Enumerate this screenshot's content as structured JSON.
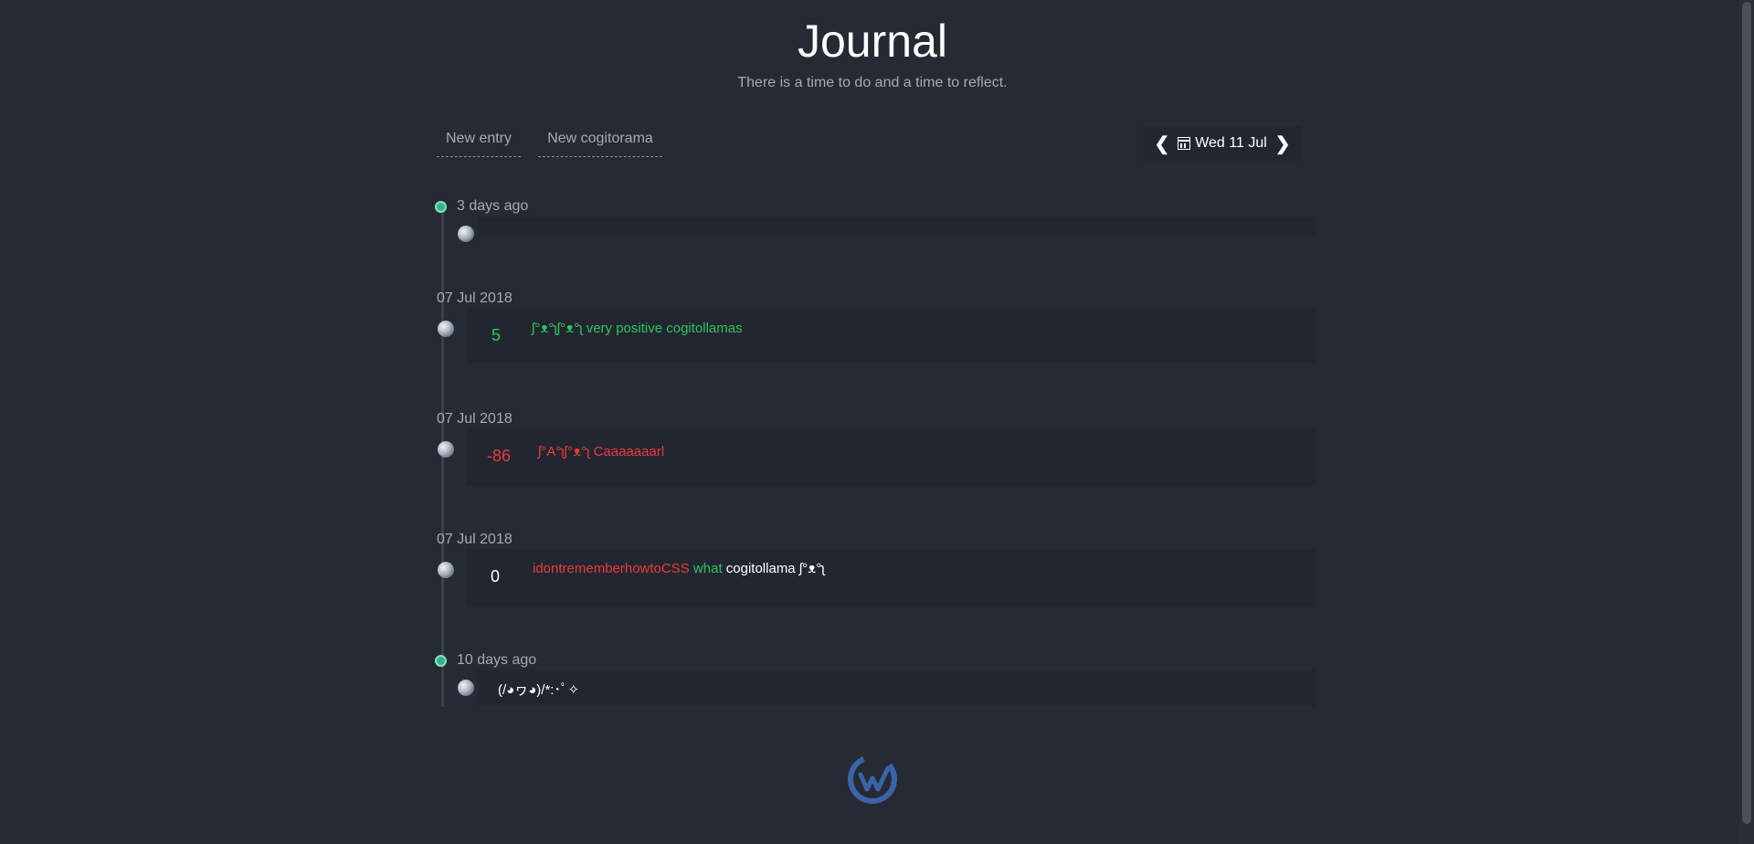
{
  "header": {
    "title": "Journal",
    "subtitle": "There is a time to do and a time to reflect."
  },
  "actions": {
    "new_entry": "New entry",
    "new_cogitorama": "New cogitorama"
  },
  "date_nav": {
    "prev_icon": "chevron-left-icon",
    "calendar_icon": "calendar-icon",
    "date": "Wed 11 Jul",
    "next_icon": "chevron-right-icon"
  },
  "timeline": {
    "group1_label": "3 days ago",
    "entry1_text": "",
    "cogi1": {
      "date": "07 Jul 2018",
      "score": "5",
      "text": "ʃ°ᴥ°ʅʃ°ᴥ°ʅ very positive cogitollamas"
    },
    "cogi2": {
      "date": "07 Jul 2018",
      "score": "-86",
      "text": "ʃ°A°ʅʃ°ᴥ°ʅ Caaaaaaarl"
    },
    "cogi3": {
      "date": "07 Jul 2018",
      "score": "0",
      "part1": "idontrememberhowtoCSS",
      "part2": "what",
      "part3": "cogitollama ʃ°ᴥ°ʅ"
    },
    "group2_label": "10 days ago",
    "entry2_text": "(/◕ヮ◕)/*:･ﾟ✧"
  },
  "colors": {
    "background": "#262a33",
    "card": "#222630",
    "positive": "#2ec45a",
    "negative": "#ec3a3a",
    "timeline_dot": "#38b08a",
    "logo": "#3b63a8"
  },
  "footer": {
    "logo_icon": "app-logo-icon"
  }
}
